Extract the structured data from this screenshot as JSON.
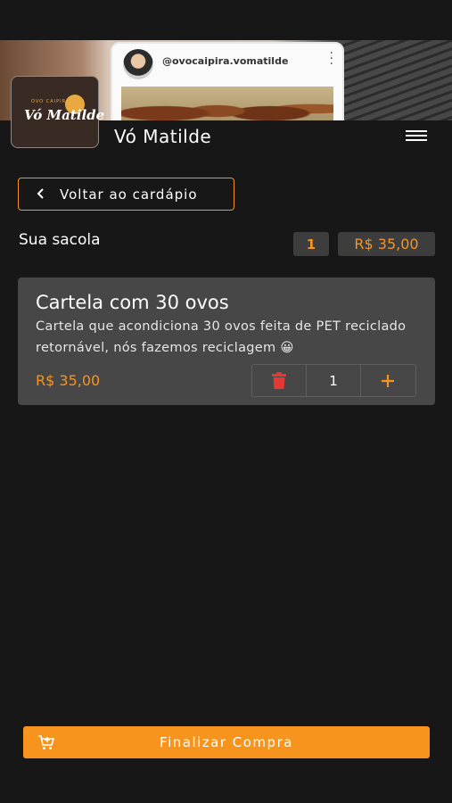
{
  "banner": {
    "handle": "@ovocaipira.vomatilde"
  },
  "logo": {
    "small_text": "OVO CAIPIRA",
    "text": "Vó Matilde"
  },
  "header": {
    "brand_name": "Vó Matilde",
    "menu_icon": "hamburger-icon"
  },
  "back_button": {
    "label": "Voltar ao cardápio",
    "icon": "chevron-left-icon"
  },
  "bag": {
    "title": "Sua sacola",
    "count": "1",
    "total": "R$ 35,00"
  },
  "items": [
    {
      "title": "Cartela com 30 ovos",
      "description": "Cartela que acondiciona 30 ovos feita de PET reciclado retornável, nós fazemos reciclagem 😀",
      "price": "R$ 35,00",
      "quantity": "1",
      "delete_icon": "trash-icon",
      "add_icon": "plus-icon"
    }
  ],
  "checkout": {
    "label": "Finalizar Compra",
    "icon": "cart-plus-icon"
  },
  "colors": {
    "accent": "#f7941d",
    "background": "#171717",
    "card": "#474747",
    "danger": "#e53935"
  }
}
